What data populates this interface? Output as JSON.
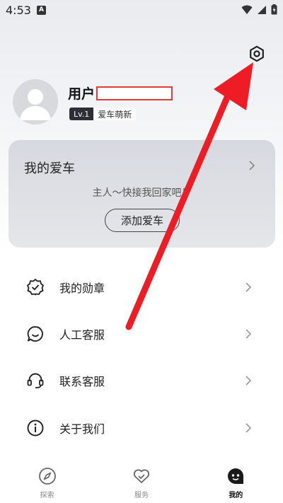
{
  "status_bar": {
    "time": "4:53",
    "notif_letter": "A"
  },
  "profile": {
    "username": "用户",
    "level": "Lv.1",
    "level_title": "爱车萌新"
  },
  "car_card": {
    "title": "我的爱车",
    "prompt": "主人～快接我回家吧！",
    "add_button": "添加爱车"
  },
  "menu": {
    "items": [
      {
        "label": "我的勋章",
        "icon": "badge-check-icon"
      },
      {
        "label": "人工客服",
        "icon": "chat-smile-icon"
      },
      {
        "label": "联系客服",
        "icon": "headset-icon"
      },
      {
        "label": "关于我们",
        "icon": "info-icon"
      }
    ]
  },
  "bottom_nav": {
    "tabs": [
      {
        "label": "探索",
        "icon": "compass-icon"
      },
      {
        "label": "服务",
        "icon": "heart-check-icon"
      },
      {
        "label": "我的",
        "icon": "face-icon",
        "active": true
      }
    ]
  },
  "colors": {
    "annotation_arrow": "#ee1c25",
    "accent_dark": "#2c2f36"
  }
}
